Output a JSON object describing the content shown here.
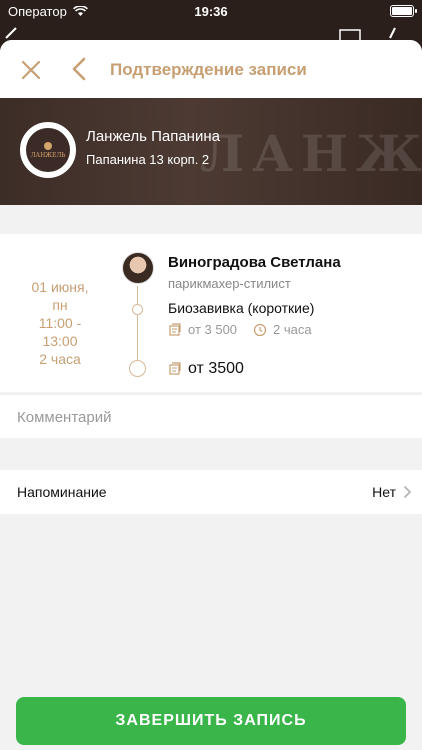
{
  "status_bar": {
    "carrier": "Оператор",
    "time": "19:36"
  },
  "nav": {
    "title": "Подтверждение записи"
  },
  "salon": {
    "name": "Ланжель Папанина",
    "address": "Папанина 13 корп. 2",
    "watermark": "ЛАНЖЕЛЬ",
    "logo_text": "ЛАНЖЕЛЬ"
  },
  "appointment": {
    "date": "01 июня,",
    "weekday": "пн",
    "time_range": "11:00 -",
    "time_end": "13:00",
    "duration": "2 часа",
    "staff_name": "Виноградова Светлана",
    "staff_role": "парикмахер-стилист",
    "service_name": "Биозавивка (короткие)",
    "service_price": "от 3 500",
    "service_duration": "2 часа",
    "total_price": "от 3500"
  },
  "comment": {
    "placeholder": "Комментарий"
  },
  "reminder": {
    "label": "Напоминание",
    "value": "Нет"
  },
  "finish_button": {
    "label": "ЗАВЕРШИТЬ ЗАПИСЬ"
  },
  "colors": {
    "accent": "#c79f73",
    "button": "#3ab54a",
    "header_bg": "#3d2d27"
  }
}
